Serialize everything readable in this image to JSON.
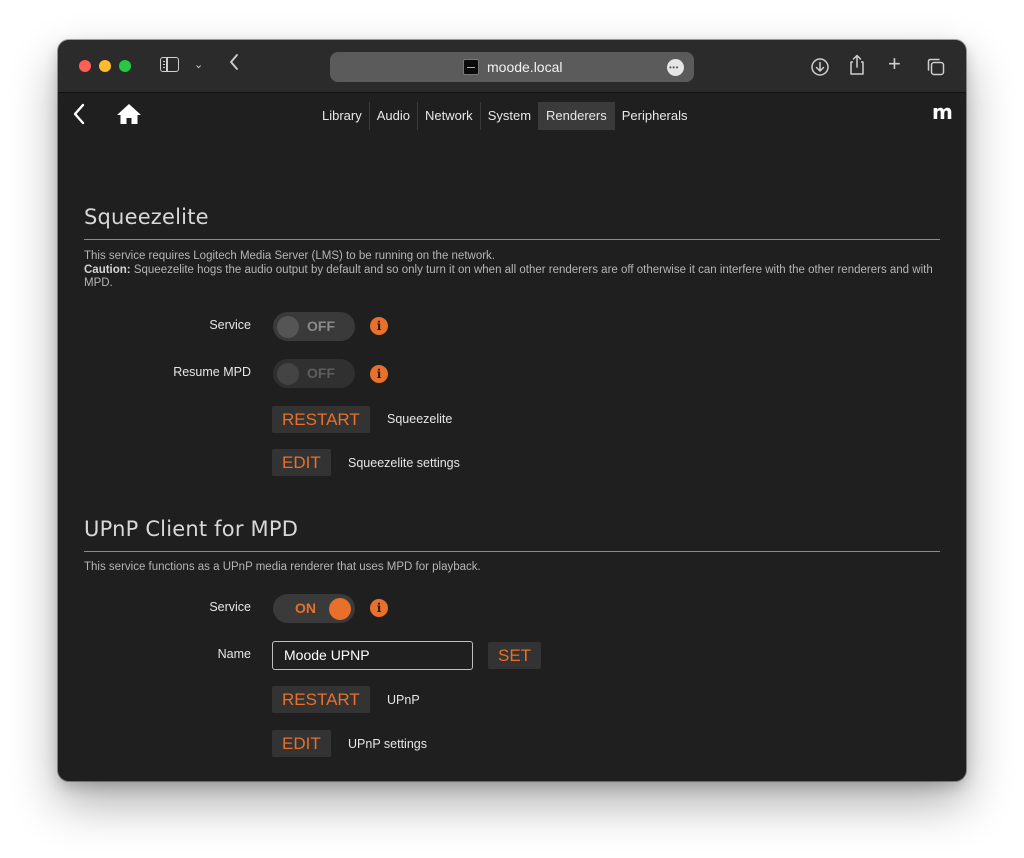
{
  "browser": {
    "url": "moode.local"
  },
  "nav": {
    "tabs": [
      {
        "label": "Library"
      },
      {
        "label": "Audio"
      },
      {
        "label": "Network"
      },
      {
        "label": "System"
      },
      {
        "label": "Renderers"
      },
      {
        "label": "Peripherals"
      }
    ],
    "active_tab": "Renderers",
    "brand": "m"
  },
  "squeezelite": {
    "title": "Squeezelite",
    "desc_line1": "This service requires Logitech Media Server (LMS) to be running on the network.",
    "caution_label": "Caution:",
    "caution_text": " Squeezelite hogs the audio output by default and so only turn it on when all other renderers are off otherwise it can interfere with the other renderers and with MPD.",
    "service_label": "Service",
    "service_state": "OFF",
    "resume_label": "Resume MPD",
    "resume_state": "OFF",
    "restart_label": "RESTART",
    "restart_caption": "Squeezelite",
    "edit_label": "EDIT",
    "edit_caption": "Squeezelite settings"
  },
  "upnp": {
    "title": "UPnP Client for MPD",
    "desc": "This service functions as a UPnP media renderer that uses MPD for playback.",
    "service_label": "Service",
    "service_state": "ON",
    "name_label": "Name",
    "name_value": "Moode UPNP",
    "set_label": "SET",
    "restart_label": "RESTART",
    "restart_caption": "UPnP",
    "edit_label": "EDIT",
    "edit_caption": "UPnP settings"
  },
  "colors": {
    "accent": "#e8702a",
    "background": "#1f1f1f",
    "toolbar": "#2b2b2b"
  },
  "icons": {
    "info": "i"
  }
}
